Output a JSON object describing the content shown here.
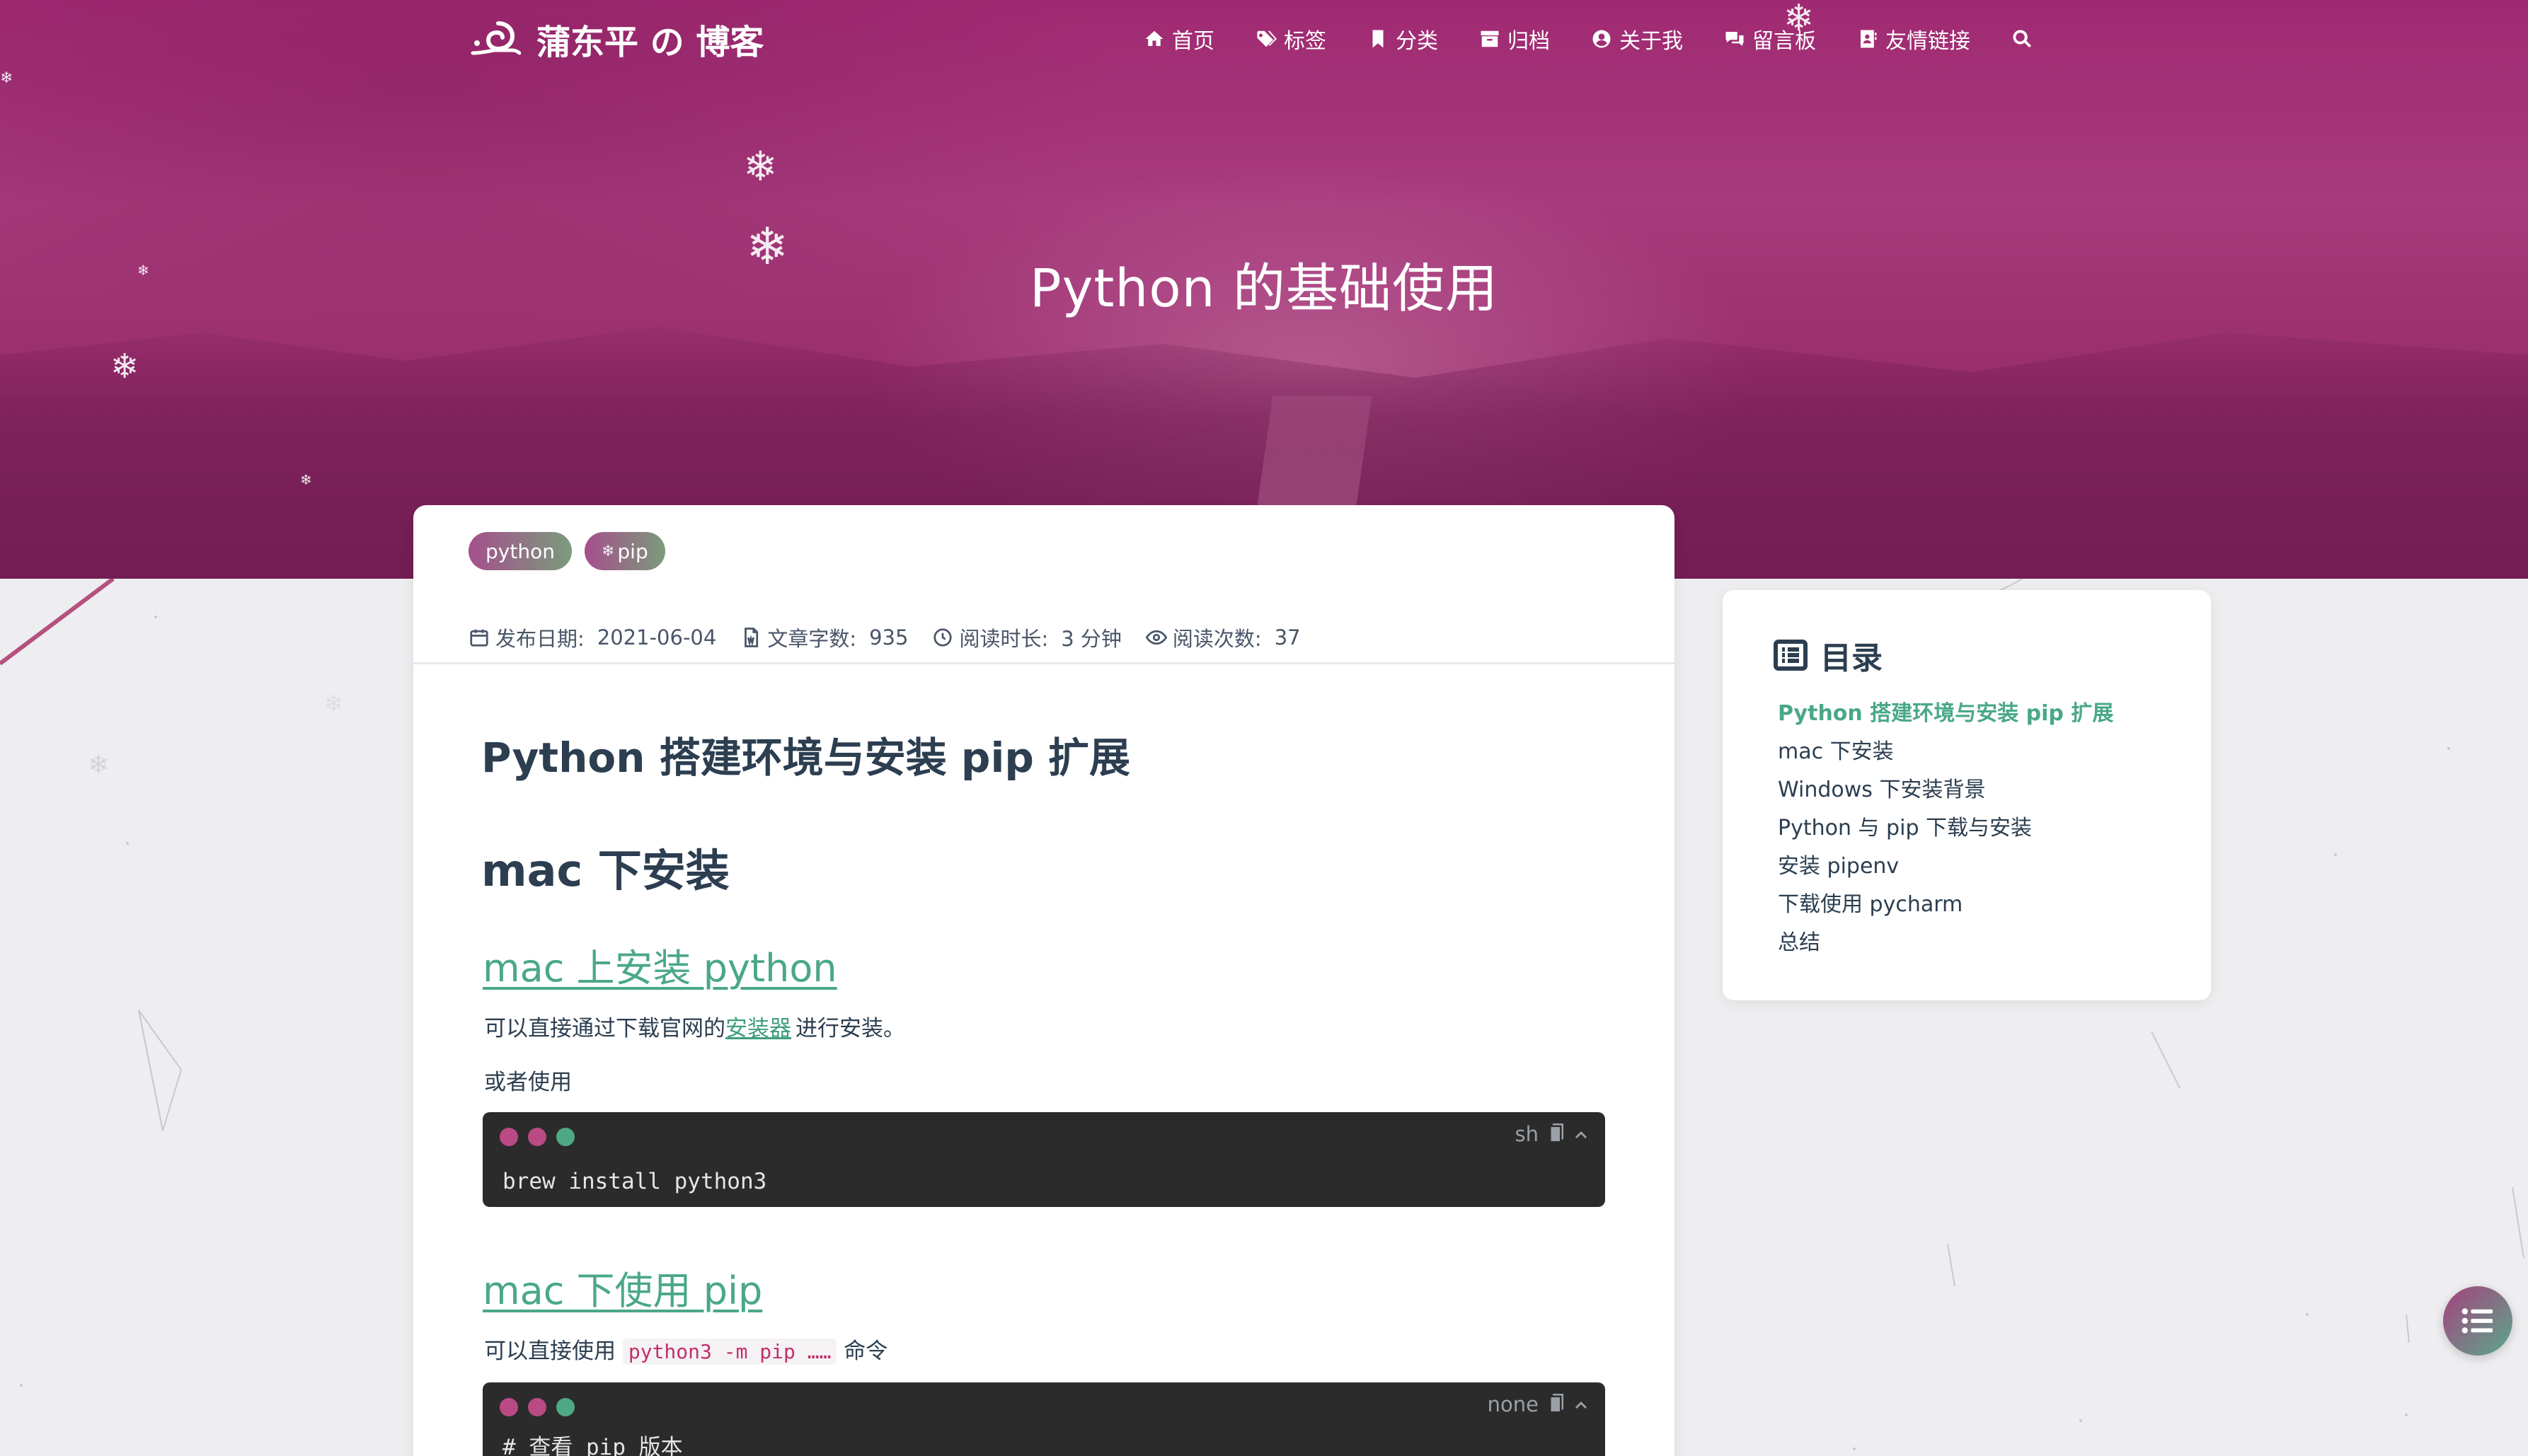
{
  "nav": {
    "brand": "蒲东平 の 博客",
    "items": [
      {
        "label": "首页",
        "icon": "home-icon"
      },
      {
        "label": "标签",
        "icon": "tags-icon"
      },
      {
        "label": "分类",
        "icon": "bookmark-icon"
      },
      {
        "label": "归档",
        "icon": "archive-icon"
      },
      {
        "label": "关于我",
        "icon": "user-icon"
      },
      {
        "label": "留言板",
        "icon": "comments-icon"
      },
      {
        "label": "友情链接",
        "icon": "address-book-icon"
      }
    ],
    "search_icon": "search-icon"
  },
  "hero": {
    "title": "Python 的基础使用"
  },
  "post": {
    "tags": [
      "python",
      "pip"
    ],
    "meta": {
      "published_label": "发布日期:",
      "published": "2021-06-04",
      "words_label": "文章字数:",
      "words": "935",
      "read_time_label": "阅读时长:",
      "read_time": "3 分钟",
      "views_label": "阅读次数:",
      "views": "37"
    },
    "h1": "Python 搭建环境与安装 pip 扩展",
    "h2": "mac 下安装",
    "sec1": {
      "heading": "mac 上安装 python",
      "para_before": "可以直接通过下载官网的",
      "para_link": "安装器",
      "para_after": "进行安装。",
      "para2": "或者使用",
      "code_lang": "sh",
      "code": "brew install python3"
    },
    "sec2": {
      "heading": "mac 下使用 pip",
      "para_before": "可以直接使用",
      "para_code": "python3 -m pip ……",
      "para_after": "命令",
      "code_lang": "none",
      "code": "# 查看 pip 版本"
    }
  },
  "toc": {
    "title": "目录",
    "items": [
      "Python 搭建环境与安装 pip 扩展",
      "mac 下安装",
      "Windows 下安装背景",
      "Python 与 pip 下载与安装",
      "安装 pipenv",
      "下载使用 pycharm",
      "总结"
    ],
    "active_index": 0
  },
  "colors": {
    "accent": "#4aa887",
    "hero": "#a02a72",
    "dot_red": "#b94a84",
    "dot_green": "#4ea886"
  }
}
